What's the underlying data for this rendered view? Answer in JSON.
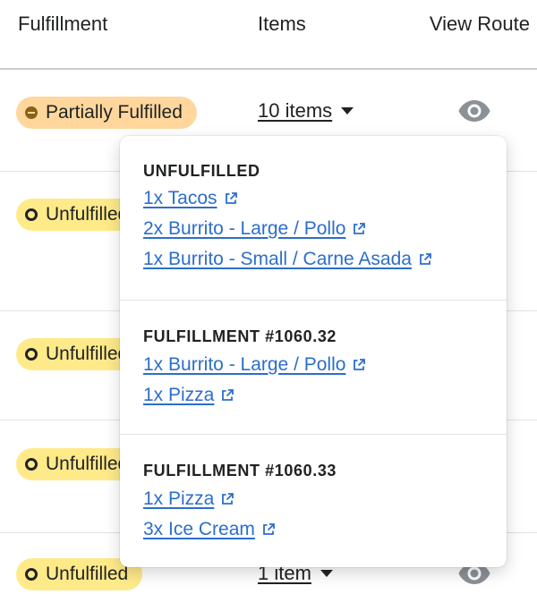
{
  "header": {
    "fulfillment": "Fulfillment",
    "items": "Items",
    "view_route": "View Route"
  },
  "rows": [
    {
      "status": "Partially Fulfilled",
      "items": "10 items"
    },
    {
      "status": "Unfulfilled",
      "items": ""
    },
    {
      "status": "Unfulfilled",
      "items": ""
    },
    {
      "status": "Unfulfilled",
      "items": ""
    },
    {
      "status": "Unfulfilled",
      "items": "1 item"
    }
  ],
  "popover": {
    "sections": [
      {
        "title": "UNFULFILLED",
        "items": [
          "1x Tacos",
          "2x Burrito - Large / Pollo",
          "1x Burrito - Small / Carne Asada"
        ]
      },
      {
        "title": "FULFILLMENT #1060.32",
        "items": [
          "1x Burrito - Large / Pollo",
          "1x Pizza"
        ]
      },
      {
        "title": "FULFILLMENT #1060.33",
        "items": [
          "1x Pizza",
          "3x Ice Cream"
        ]
      }
    ]
  },
  "icons": {
    "view": "eye-icon",
    "dropdown": "caret-down-icon",
    "external": "external-link-icon"
  },
  "colors": {
    "partial_badge": "#ffd79d",
    "unfulfilled_badge": "#ffea8a",
    "link": "#2c6ecb",
    "icon_gray": "#8c9196"
  }
}
